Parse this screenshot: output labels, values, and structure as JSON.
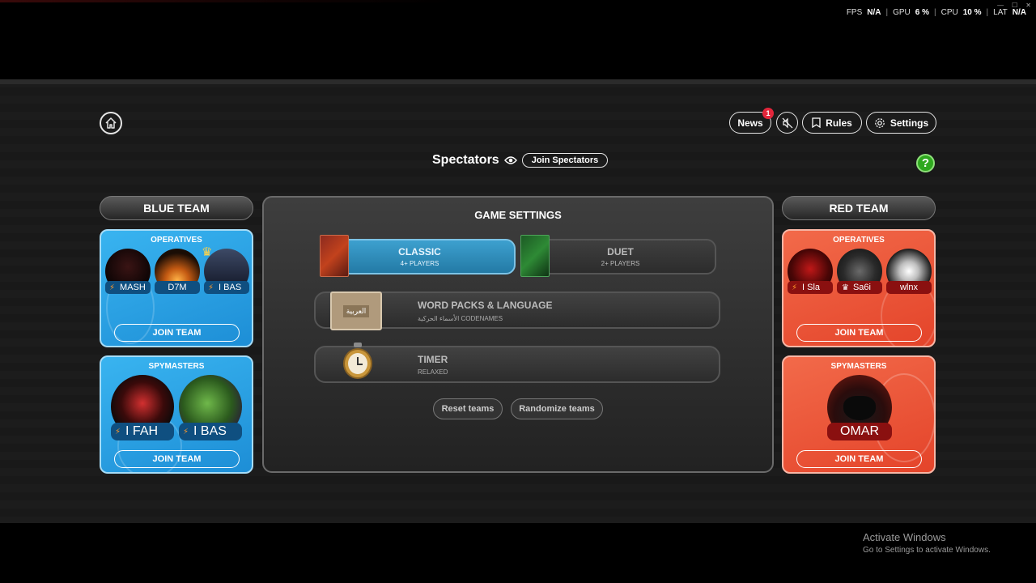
{
  "perf": {
    "fps_label": "FPS",
    "fps_value": "N/A",
    "gpu_label": "GPU",
    "gpu_value": "6 %",
    "cpu_label": "CPU",
    "cpu_value": "10 %",
    "lat_label": "LAT",
    "lat_value": "N/A"
  },
  "nav": {
    "news_label": "News",
    "news_badge": "1",
    "rules_label": "Rules",
    "settings_label": "Settings"
  },
  "spectators": {
    "title": "Spectators",
    "join_label": "Join Spectators",
    "help_label": "?"
  },
  "blue_team": {
    "title": "BLUE TEAM",
    "operatives_label": "OPERATIVES",
    "operatives": [
      {
        "name": "MASH"
      },
      {
        "name": "D7M"
      },
      {
        "name": "I BAS"
      }
    ],
    "operatives_join": "JOIN TEAM",
    "spymasters_label": "SPYMASTERS",
    "spymasters": [
      {
        "name": "I FAH"
      },
      {
        "name": "I BAS"
      }
    ],
    "spymasters_join": "JOIN TEAM"
  },
  "red_team": {
    "title": "RED TEAM",
    "operatives_label": "OPERATIVES",
    "operatives": [
      {
        "name": "I Sla"
      },
      {
        "name": "Sa6i"
      },
      {
        "name": "wlnx"
      }
    ],
    "operatives_join": "JOIN TEAM",
    "spymasters_label": "SPYMASTERS",
    "spymasters": [
      {
        "name": "OMAR"
      }
    ],
    "spymasters_join": "JOIN TEAM"
  },
  "game_settings": {
    "title": "GAME SETTINGS",
    "modes": [
      {
        "name": "CLASSIC",
        "sub": "4+ PLAYERS",
        "selected": true
      },
      {
        "name": "DUET",
        "sub": "2+ PLAYERS",
        "selected": false
      }
    ],
    "word_packs": {
      "title": "WORD PACKS & LANGUAGE",
      "sub": "الأسماء الحركية CODENAMES",
      "box_text": "العربية"
    },
    "timer": {
      "title": "TIMER",
      "sub": "RELAXED"
    },
    "reset_label": "Reset teams",
    "randomize_label": "Randomize teams"
  },
  "windows": {
    "line1": "Activate Windows",
    "line2": "Go to Settings to activate Windows."
  },
  "icons": [
    "home-icon",
    "mute-icon",
    "bookmark-icon",
    "gear-icon",
    "eye-icon",
    "bolt-icon",
    "crown-icon"
  ],
  "colors": {
    "blue": "#2aa2e8",
    "red": "#ee5536",
    "help_green": "#2fa81f",
    "news_badge": "#e3263b"
  }
}
